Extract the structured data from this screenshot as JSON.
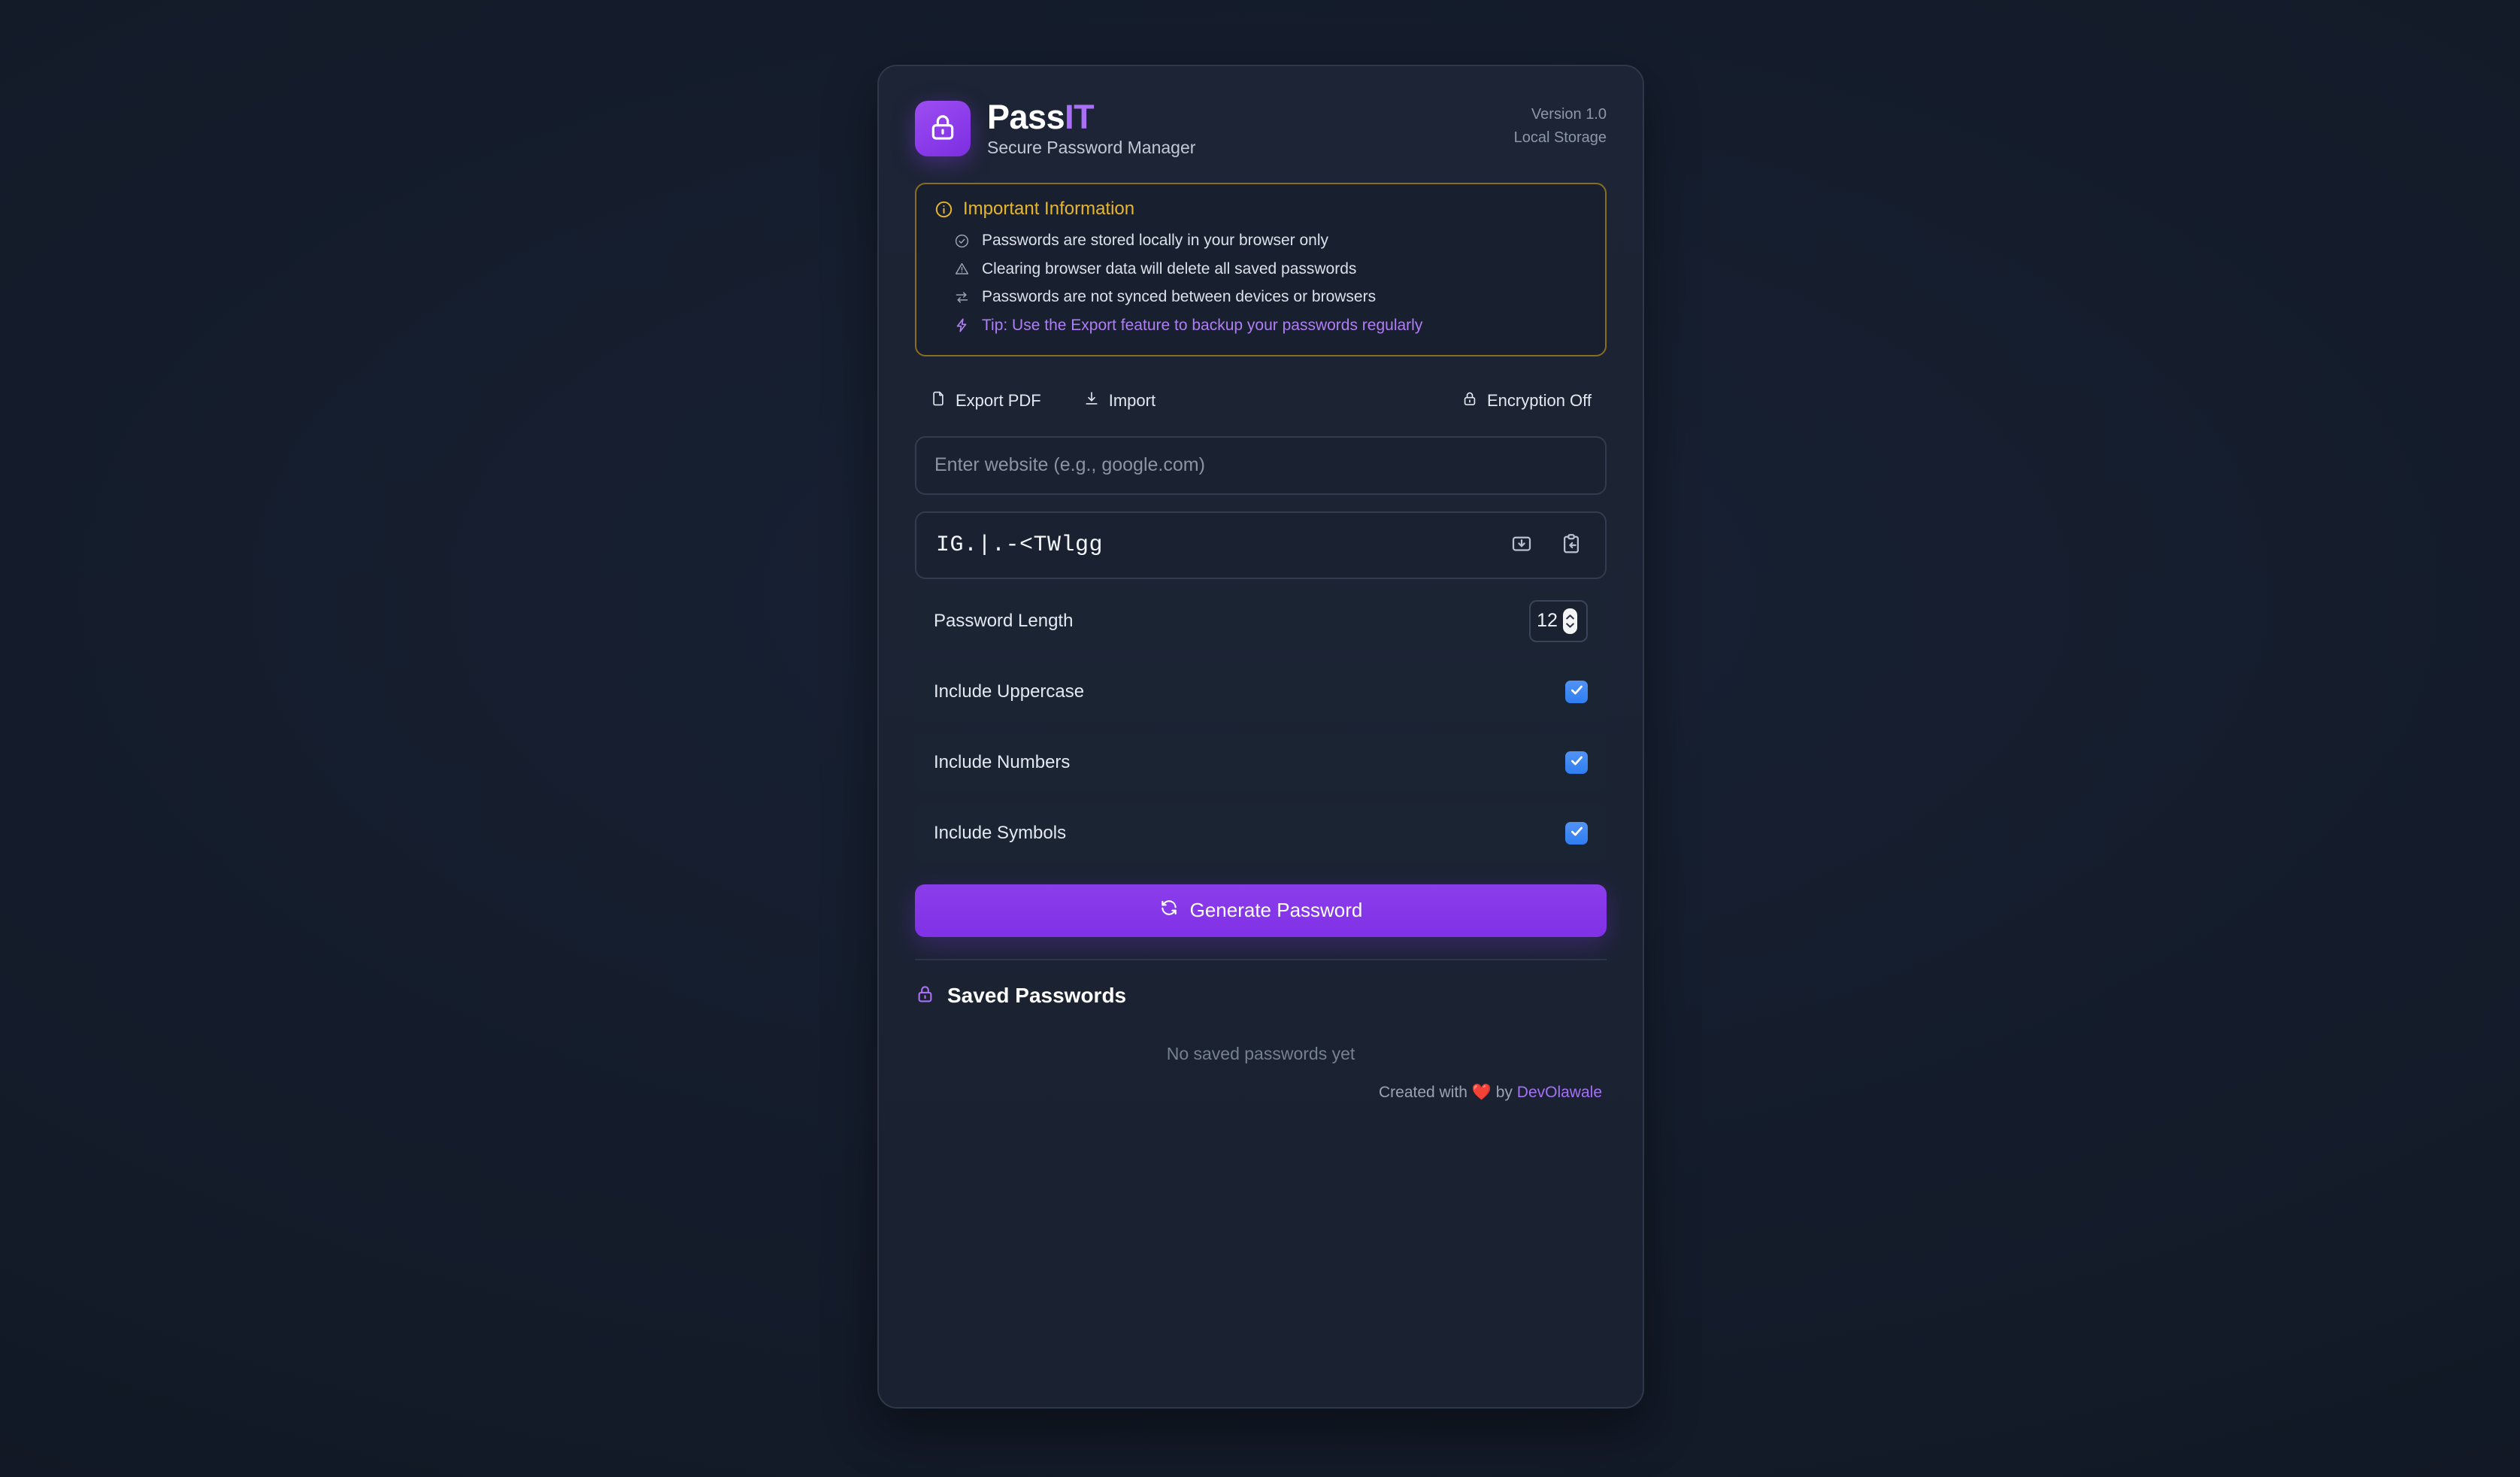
{
  "app": {
    "title_main": "Pass",
    "title_accent": "IT",
    "subtitle": "Secure Password Manager",
    "logo_icon": "lock-icon",
    "version": "Version 1.0",
    "storage": "Local Storage"
  },
  "info_box": {
    "icon": "info-circle-icon",
    "heading": "Important Information",
    "items": [
      {
        "icon": "check-circle-icon",
        "text": "Passwords are stored locally in your browser only",
        "style": "normal"
      },
      {
        "icon": "warning-triangle-icon",
        "text": "Clearing browser data will delete all saved passwords",
        "style": "normal"
      },
      {
        "icon": "sync-arrows-icon",
        "text": "Passwords are not synced between devices or browsers",
        "style": "normal"
      },
      {
        "icon": "lightning-bolt-icon",
        "text": "Tip: Use the Export feature to backup your passwords regularly",
        "style": "tip"
      }
    ]
  },
  "toolbar": {
    "export_label": "Export PDF",
    "export_icon": "file-icon",
    "import_label": "Import",
    "import_icon": "download-icon",
    "encryption_label": "Encryption Off",
    "encryption_icon": "lock-icon"
  },
  "website_field": {
    "placeholder": "Enter website (e.g., google.com)",
    "value": ""
  },
  "password_field": {
    "value": "IG.|.-<TWlgg",
    "save_icon": "save-download-icon",
    "copy_icon": "clipboard-copy-icon"
  },
  "options": {
    "length": {
      "label": "Password Length",
      "value": "12"
    },
    "toggles": [
      {
        "label": "Include Uppercase",
        "checked": true
      },
      {
        "label": "Include Numbers",
        "checked": true
      },
      {
        "label": "Include Symbols",
        "checked": true
      }
    ]
  },
  "generate": {
    "label": "Generate Password",
    "icon": "refresh-icon"
  },
  "saved": {
    "icon": "lock-icon",
    "title": "Saved Passwords",
    "empty_text": "No saved passwords yet"
  },
  "footer": {
    "prefix": "Created with",
    "heart": "❤️",
    "middle": "by",
    "author": "DevOlawale"
  },
  "colors": {
    "accent_purple": "#8b3deb",
    "accent_light_purple": "#a970f7",
    "warning_amber": "#e8b62c",
    "checkbox_blue": "#3b82f6",
    "card_bg": "#1c2435",
    "page_bg": "#141c2b"
  }
}
